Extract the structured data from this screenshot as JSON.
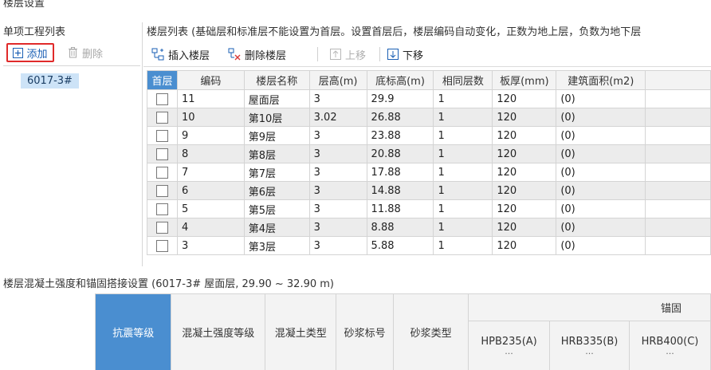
{
  "window": {
    "title": "楼层设置"
  },
  "left_panel": {
    "title": "单项工程列表",
    "add_label": "添加",
    "delete_label": "删除",
    "items": [
      "6017-3#"
    ]
  },
  "right_panel": {
    "title": "楼层列表 (基础层和标准层不能设置为首层。设置首层后，楼层编码自动变化，正数为地上层，负数为地下层",
    "toolbar": {
      "insert_label": "插入楼层",
      "delete_label": "删除楼层",
      "up_label": "上移",
      "down_label": "下移"
    },
    "columns": [
      "首层",
      "编码",
      "楼层名称",
      "层高(m)",
      "底标高(m)",
      "相同层数",
      "板厚(mm)",
      "建筑面积(m2)"
    ],
    "rows": [
      {
        "code": "11",
        "name": "屋面层",
        "height": "3",
        "base": "29.9",
        "same": "1",
        "slab": "120",
        "area": "(0)"
      },
      {
        "code": "10",
        "name": "第10层",
        "height": "3.02",
        "base": "26.88",
        "same": "1",
        "slab": "120",
        "area": "(0)"
      },
      {
        "code": "9",
        "name": "第9层",
        "height": "3",
        "base": "23.88",
        "same": "1",
        "slab": "120",
        "area": "(0)"
      },
      {
        "code": "8",
        "name": "第8层",
        "height": "3",
        "base": "20.88",
        "same": "1",
        "slab": "120",
        "area": "(0)"
      },
      {
        "code": "7",
        "name": "第7层",
        "height": "3",
        "base": "17.88",
        "same": "1",
        "slab": "120",
        "area": "(0)"
      },
      {
        "code": "6",
        "name": "第6层",
        "height": "3",
        "base": "14.88",
        "same": "1",
        "slab": "120",
        "area": "(0)"
      },
      {
        "code": "5",
        "name": "第5层",
        "height": "3",
        "base": "11.88",
        "same": "1",
        "slab": "120",
        "area": "(0)"
      },
      {
        "code": "4",
        "name": "第4层",
        "height": "3",
        "base": "8.88",
        "same": "1",
        "slab": "120",
        "area": "(0)"
      },
      {
        "code": "3",
        "name": "第3层",
        "height": "3",
        "base": "5.88",
        "same": "1",
        "slab": "120",
        "area": "(0)"
      }
    ]
  },
  "bottom": {
    "title": "楼层混凝土强度和锚固搭接设置 (6017-3# 屋面层, 29.90 ~ 32.90 m)",
    "group_label": "锚固",
    "headers": [
      "抗震等级",
      "混凝土强度等级",
      "混凝土类型",
      "砂浆标号",
      "砂浆类型"
    ],
    "rebar_headers": [
      "HPB235(A)",
      "HRB335(B)",
      "HRB400(C)"
    ],
    "ellipsis": "..."
  },
  "colors": {
    "accent": "#4a8ed0",
    "highlight_border": "#e02a2a",
    "selection": "#cde3f7",
    "link_blue": "#1a5fb4"
  }
}
